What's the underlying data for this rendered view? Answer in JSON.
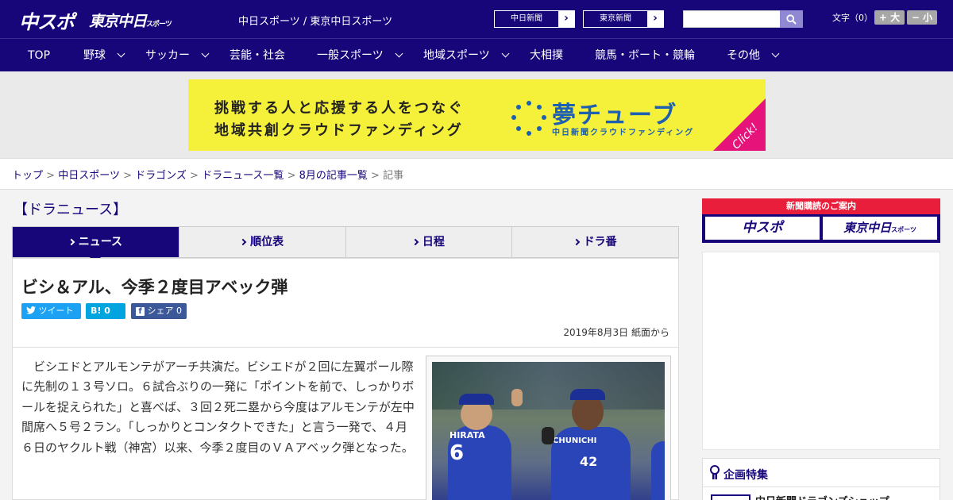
{
  "header": {
    "logo_chuspo": "中スポ",
    "logo_tokyo": "東京中日",
    "logo_tokyo_suffix": "スポーツ",
    "site_name": "中日スポーツ / 東京中日スポーツ",
    "paper_links": [
      "中日新聞",
      "東京新聞"
    ],
    "search": {
      "placeholder": ""
    },
    "text_size_label": "文字（0）",
    "size_up": "+ 大",
    "size_down": "− 小"
  },
  "nav": {
    "items": [
      {
        "label": "TOP",
        "has_menu": false
      },
      {
        "label": "野球",
        "has_menu": true
      },
      {
        "label": "サッカー",
        "has_menu": true
      },
      {
        "label": "芸能・社会",
        "has_menu": false
      },
      {
        "label": "一般スポーツ",
        "has_menu": true
      },
      {
        "label": "地域スポーツ",
        "has_menu": true
      },
      {
        "label": "大相撲",
        "has_menu": false
      },
      {
        "label": "競馬・ボート・競輪",
        "has_menu": false
      },
      {
        "label": "その他",
        "has_menu": true
      }
    ]
  },
  "ad": {
    "line1": "挑戦する人と応援する人をつなぐ",
    "line2": "地域共創クラウドファンディング",
    "brand": "夢チューブ",
    "brand_sub": "中日新聞クラウドファンディング",
    "click": "Click!",
    "accent": "#f5f03a"
  },
  "breadcrumb": {
    "items": [
      "トップ",
      "中日スポーツ",
      "ドラゴンズ",
      "ドラニュース一覧",
      "8月の記事一覧"
    ],
    "current": "記事",
    "separator": ">"
  },
  "section_title": "【ドラニュース】",
  "tabs": [
    {
      "label": "ニュース",
      "active": true
    },
    {
      "label": "順位表",
      "active": false
    },
    {
      "label": "日程",
      "active": false
    },
    {
      "label": "ドラ番",
      "active": false
    }
  ],
  "article": {
    "headline": "ビシ＆アル、今季２度目アベック弾",
    "share": {
      "tweet": "ツイート",
      "hatena": "B! 0",
      "facebook": "シェア 0"
    },
    "dateline": "2019年8月3日 紙面から",
    "body": "ビシエドとアルモンテがアーチ共演だ。ビシエドが２回に左翼ポール際に先制の１３号ソロ。６試合ぶりの一発に「ポイントを前で、しっかりボールを捉えられた」と喜べば、３回２死二塁から今度はアルモンテが左中間席へ５号２ラン。「しっかりとコンタクトできた」と言う一発で、４月６日のヤクルト戦（神宮）以来、今季２度目のＶＡアベック弾となった。",
    "photo_jerseys": {
      "left_name": "HIRATA",
      "left_number": "6",
      "right_name": "CHUNICHI",
      "right_number": "42"
    }
  },
  "sidebar": {
    "subscribe_label": "新聞購読のご案内",
    "papers": [
      "中スポ",
      "東京中日"
    ],
    "paper_suffix": "スポーツ",
    "feature_title": "企画特集",
    "feature_item": "中日新聞ドラゴンズショップ"
  },
  "colors": {
    "brand": "#16067a",
    "accent_red": "#e81e3a",
    "bg": "#f3f3f3"
  }
}
